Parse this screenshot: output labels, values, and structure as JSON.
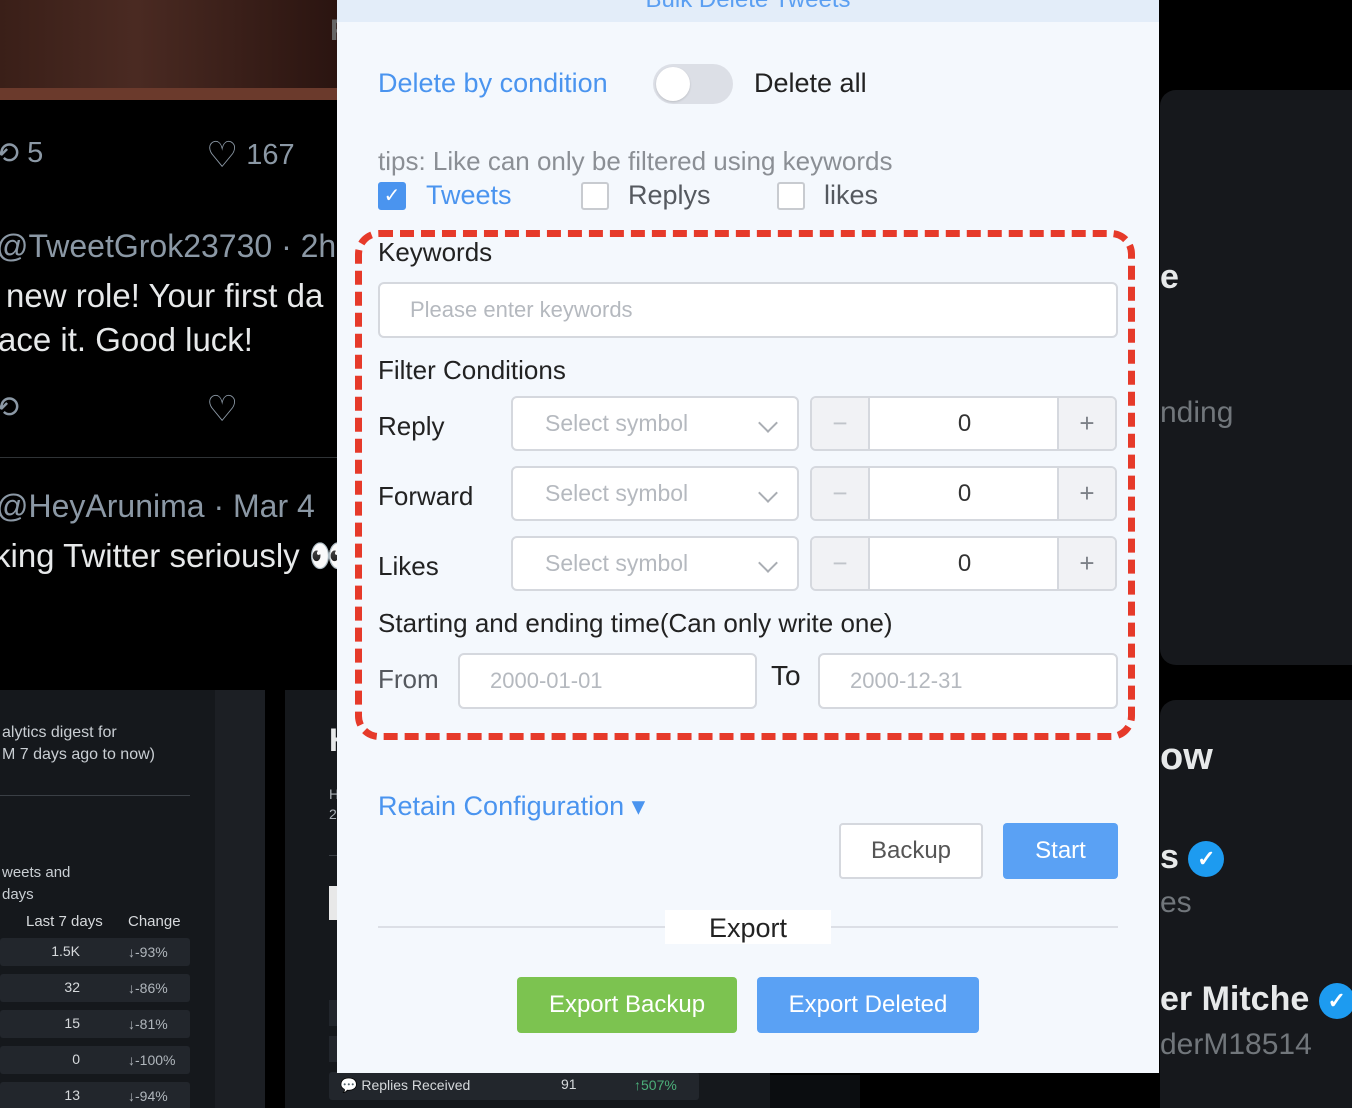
{
  "background": {
    "tweet1_retweets": "5",
    "tweet1_likes": "167",
    "tweet2_handle": "@TweetGrok23730 · 2h",
    "tweet2_line1": "new role! Your first da",
    "tweet2_line2": "ace it. Good luck!",
    "tweet3_handle": "@HeyArunima · Mar 4",
    "tweet3_text": "king Twitter seriously 👀",
    "top_partial": "F",
    "analytics": {
      "digest_line1": "alytics digest for",
      "digest_line2": "M 7 days ago to now)",
      "tweets_and": "weets and",
      "days": "days",
      "col_last7": "Last 7 days",
      "col_change": "Change",
      "rows": [
        {
          "value": "1.5K",
          "change": "↓-93%"
        },
        {
          "value": "32",
          "change": "↓-86%"
        },
        {
          "value": "15",
          "change": "↓-81%"
        },
        {
          "value": "0",
          "change": "↓-100%"
        },
        {
          "value": "13",
          "change": "↓-94%"
        }
      ],
      "mid_h": "H",
      "mid_h2": "H",
      "mid_2": "2",
      "replies_label": "Replies Received",
      "replies_value": "91",
      "replies_change": "↑507%"
    },
    "right": {
      "partial_1": "e",
      "partial_2": "nding",
      "partial_3": "ow",
      "partial_4": "s",
      "partial_5": "es",
      "partial_6": "er Mitche",
      "partial_7": "derM18514"
    }
  },
  "modal": {
    "title": "Bulk Delete Tweets",
    "mode_left": "Delete by condition",
    "mode_right": "Delete all",
    "tips": "tips: Like can only be filtered using keywords",
    "types": [
      {
        "label": "Tweets",
        "checked": true
      },
      {
        "label": "Replys",
        "checked": false
      },
      {
        "label": "likes",
        "checked": false
      }
    ],
    "keywords_label": "Keywords",
    "keywords_placeholder": "Please enter keywords",
    "filter_label": "Filter Conditions",
    "conditions": [
      {
        "label": "Reply",
        "symbol_placeholder": "Select symbol",
        "value": "0"
      },
      {
        "label": "Forward",
        "symbol_placeholder": "Select symbol",
        "value": "0"
      },
      {
        "label": "Likes",
        "symbol_placeholder": "Select symbol",
        "value": "0"
      }
    ],
    "stepper_minus": "−",
    "stepper_plus": "+",
    "time_label": "Starting and ending time(Can only write one)",
    "from_label": "From",
    "from_placeholder": "2000-01-01",
    "to_label": "To",
    "to_placeholder": "2000-12-31",
    "retain_label": "Retain Configuration ▾",
    "backup_button": "Backup",
    "start_button": "Start",
    "export_label": "Export",
    "export_backup_button": "Export Backup",
    "export_deleted_button": "Export Deleted",
    "colors": {
      "accent": "#4a94ef",
      "green": "#7cc350",
      "highlight": "#e63a2a"
    }
  }
}
